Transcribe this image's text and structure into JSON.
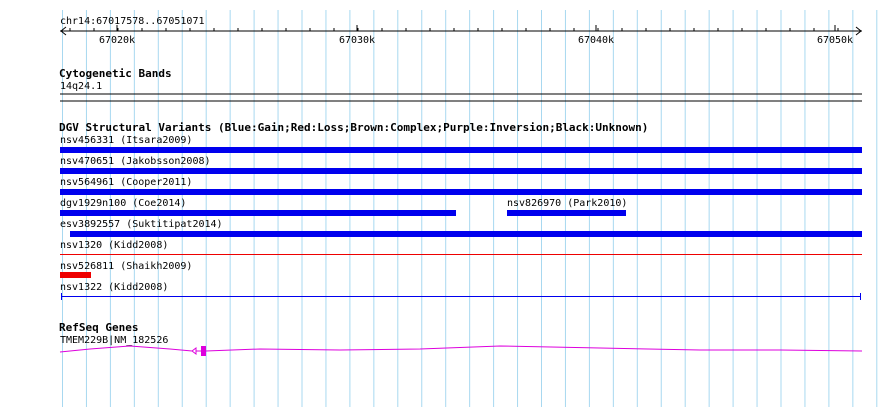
{
  "ruler": {
    "location": "chr14:67017578..67051071",
    "ticks": [
      "67020k",
      "67030k",
      "67040k",
      "67050k"
    ]
  },
  "tracks": {
    "cytoband": {
      "title": "Cytogenetic Bands",
      "band_label": "14q24.1"
    },
    "dgv": {
      "title": "DGV Structural Variants (Blue:Gain;Red:Loss;Brown:Complex;Purple:Inversion;Black:Unknown)",
      "features": [
        {
          "label": "nsv456331 (Itsara2009)",
          "type": "gain"
        },
        {
          "label": "nsv470651 (Jakobsson2008)",
          "type": "gain"
        },
        {
          "label": "nsv564961 (Cooper2011)",
          "type": "gain"
        },
        {
          "label": "dgv1929n100 (Coe2014)",
          "type": "gain"
        },
        {
          "label": "nsv826970 (Park2010)",
          "type": "gain"
        },
        {
          "label": "esv3892557 (Suktitipat2014)",
          "type": "gain"
        },
        {
          "label": "nsv1320 (Kidd2008)",
          "type": "loss"
        },
        {
          "label": "nsv526811 (Shaikh2009)",
          "type": "loss"
        },
        {
          "label": "nsv1322 (Kidd2008)",
          "type": "gain"
        }
      ]
    },
    "refseq": {
      "title": "RefSeq Genes",
      "gene_label": "TMEM229B|NM_182526"
    }
  },
  "colors": {
    "gain": "#0000ee",
    "loss": "#ee0000",
    "gene": "#dd00dd",
    "grid": "#a8d8f0"
  }
}
